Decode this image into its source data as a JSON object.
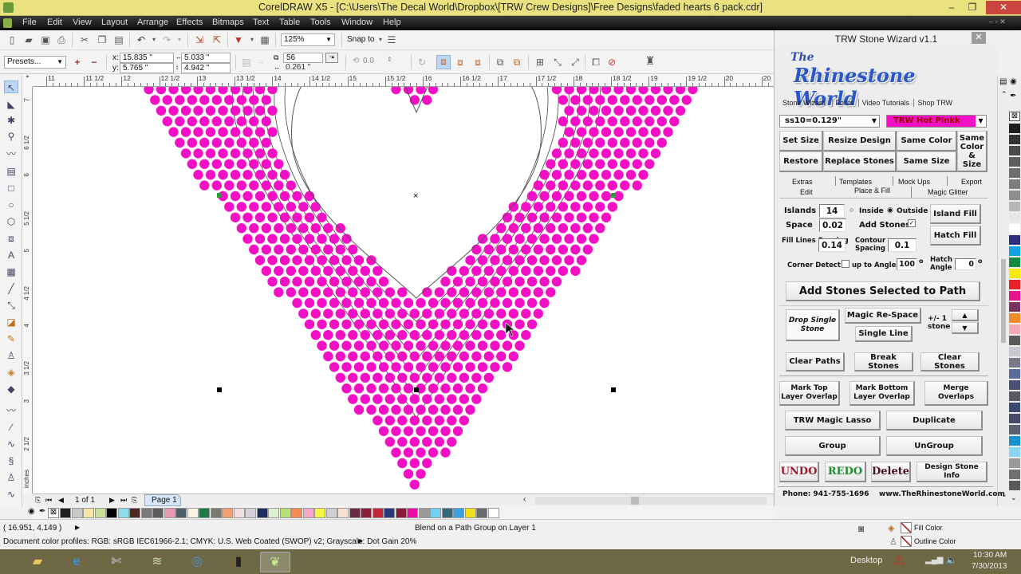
{
  "window": {
    "title": "CorelDRAW X5 - [C:\\Users\\The Decal World\\Dropbox\\[TRW Crew Designs]\\Free Designs\\faded hearts 6 pack.cdr]",
    "minimize": "–",
    "maximize": "❐",
    "close": "✕"
  },
  "menu": [
    "File",
    "Edit",
    "View",
    "Layout",
    "Arrange",
    "Effects",
    "Bitmaps",
    "Text",
    "Table",
    "Tools",
    "Window",
    "Help"
  ],
  "toolbar": {
    "zoom_level": "125%",
    "snap_to": "Snap to",
    "presets": "Presets...",
    "x": "15.835 \"",
    "y": "5.765 \"",
    "x_label": "x:",
    "y_label": "y:",
    "width": "5.033 \"",
    "height": "4.942 \"",
    "steps": "56",
    "spacing": "0.261 \"",
    "angle": "0.0"
  },
  "ruler_h": [
    "11",
    "11 1/2",
    "12",
    "12 1/2",
    "13",
    "13 1/2",
    "14",
    "14 1/2",
    "15",
    "15 1/2",
    "16",
    "16 1/2",
    "17",
    "17 1/2",
    "18",
    "18 1/2",
    "19",
    "19 1/2",
    "20",
    "20"
  ],
  "ruler_v": [
    "7",
    "6 1/2",
    "6",
    "5 1/2",
    "5",
    "4 1/2",
    "4",
    "3 1/2",
    "3",
    "2 1/2"
  ],
  "ruler_unit": "inches",
  "canvas": {
    "stone_color": "#f20fc4",
    "path_color": "#444444"
  },
  "page_nav": {
    "page_count": "1 of 1",
    "page_tab": "Page 1"
  },
  "palette": [
    "#1e1e1e",
    "#c8c8c8",
    "#f5e6a6",
    "#c8de9a",
    "#000000",
    "#8fdcef",
    "#4a2a22",
    "#7a7a7a",
    "#5c5c5c",
    "#e899b4",
    "#4f5f6a",
    "#fbf4e4",
    "#1f7a43",
    "#7a7a70",
    "#f3a070",
    "#f2dde0",
    "#d8d0dc",
    "#1e2d5e",
    "#dff0d0",
    "#b7e07a",
    "#f7884e",
    "#f4a8c8",
    "#f5f542",
    "#cfcfcf",
    "#fae2d0",
    "#6a2a40",
    "#8a2038",
    "#c02838",
    "#2a3a7a",
    "#8a1a3a",
    "#f00aa8",
    "#9a9a9a",
    "#72d0f0",
    "#3a6a7a",
    "#3aa0e0",
    "#f0e020",
    "#6a6a6a",
    "#ffffff"
  ],
  "right_palette": [
    "#1e1e1e",
    "#333333",
    "#4a4a4a",
    "#5e5e5e",
    "#6e6e6e",
    "#7e7e7e",
    "#8e8e8e",
    "#b8b8b8",
    "#e6e6e6",
    "#ffffff",
    "#2d2f7a",
    "#13a3e4",
    "#138a42",
    "#f5ea0c",
    "#e8202a",
    "#e8128c",
    "#7a3260",
    "#f08a2a",
    "#f4aab8",
    "#5a5a5a",
    "#c8c8d0",
    "#7a7a8a",
    "#5a6a9a",
    "#4a5070",
    "#5a5a6a",
    "#3a4a6a",
    "#4a4a6a",
    "#5a6070",
    "#1a90d0",
    "#8ad4f4",
    "#9a9a9a",
    "#707070",
    "#5a5a5a"
  ],
  "status": {
    "coords": "( 16.951, 4.149 )",
    "object_info": "Blend on a Path Group on Layer 1",
    "profiles": "Document color profiles: RGB: sRGB IEC61966-2.1; CMYK: U.S. Web Coated (SWOP) v2; Grayscale: Dot Gain 20%",
    "fill_color": "Fill Color",
    "outline_color": "Outline Color"
  },
  "taskbar": {
    "desktop": "Desktop",
    "time": "10:30 AM",
    "date": "7/30/2013"
  },
  "docker": {
    "title": "TRW Stone Wizard v1.1",
    "logo_line1": "The",
    "logo_line2": "Rhinestone World",
    "tabs": [
      "Stone Wizard",
      "Fonts",
      "Video Tutorials",
      "Shop TRW"
    ],
    "stone_size": "ss10=0.129\"",
    "stone_color_name": "TRW Hot Pinkk",
    "stone_color_hex": "#f20fc4",
    "buttons": {
      "set_size": "Set Size",
      "resize_design": "Resize Design",
      "same_color": "Same Color",
      "same_color_size": "Same Color & Size",
      "restore": "Restore",
      "replace_stones": "Replace Stones",
      "same_size": "Same Size",
      "island_fill": "Island Fill",
      "hatch_fill": "Hatch Fill",
      "add_stones_path": "Add Stones Selected to Path",
      "drop_single": "Drop Single Stone",
      "magic_respace": "Magic Re-Space",
      "single_line": "Single Line",
      "clear_paths": "Clear Paths",
      "break_stones": "Break Stones",
      "clear_stones": "Clear Stones",
      "mark_top": "Mark Top Layer Overlap",
      "mark_bottom": "Mark Bottom Layer Overlap",
      "merge": "Merge Overlaps",
      "magic_lasso": "TRW Magic Lasso",
      "duplicate": "Duplicate",
      "group": "Group",
      "ungroup": "UnGroup",
      "undo": "UNDO",
      "redo": "REDO",
      "delete": "Delete",
      "design_info": "Design Stone Info"
    },
    "subtabs_top": [
      "Extras",
      "Templates",
      "Mock Ups",
      "Export"
    ],
    "subtabs_bottom": [
      "Edit",
      "Place & Fill",
      "Magic Glitter"
    ],
    "fields": {
      "islands_label": "Islands",
      "islands": "14",
      "inside": "Inside",
      "outside": "Outside",
      "space_label": "Space",
      "space": "0.02",
      "add_stones": "Add Stones",
      "fill_lines_label": "Fill Lines Spacing",
      "fill_lines": "0.14",
      "contour_label": "Contour Spacing",
      "contour": "0.1",
      "corner_detect": "Corner Detect",
      "up_to_angle": "up to Angle",
      "angle": "100",
      "hatch_angle_label": "Hatch Angle",
      "hatch_angle": "0",
      "degree": "o",
      "plus_minus": "+/- 1 stone"
    },
    "footer": "Phone: 941-755-1696    www.TheRhinestoneWorld.com"
  }
}
